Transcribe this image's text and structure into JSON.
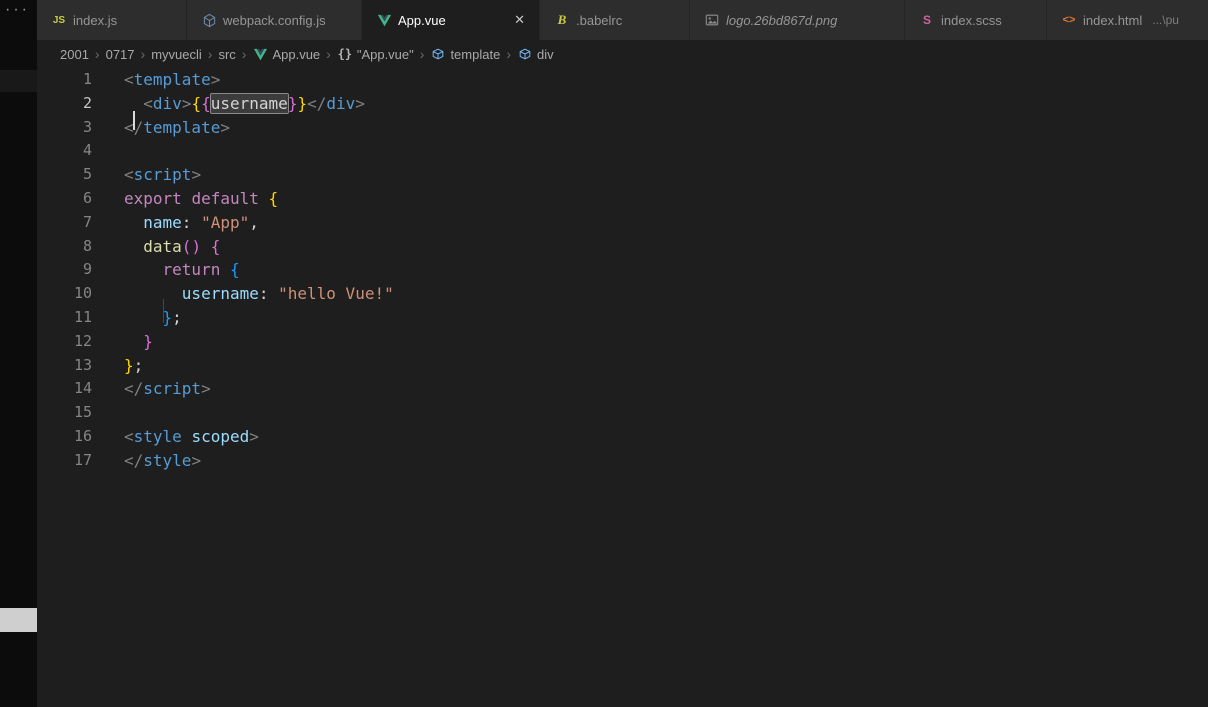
{
  "colors": {
    "editor_bg": "#1e1e1e",
    "tabbar_bg": "#252526",
    "tab_inactive_bg": "#2d2d2d",
    "activity_bar_bg": "#0c0c0c",
    "vue_green": "#41b883",
    "tag_blue": "#569cd6",
    "string_orange": "#ce9178",
    "keyword_purple": "#c586c0"
  },
  "activity_bar": {
    "overflow_label": "···"
  },
  "breadcrumb_separator": "›",
  "tab_bar": {
    "tabs": [
      {
        "label": "index.js",
        "icon": "javascript",
        "active": false,
        "italic": false
      },
      {
        "label": "webpack.config.js",
        "icon": "webpack",
        "active": false,
        "italic": false
      },
      {
        "label": "App.vue",
        "icon": "vue",
        "active": true,
        "italic": false,
        "close_label": "✕"
      },
      {
        "label": ".babelrc",
        "icon": "babel",
        "active": false,
        "italic": false
      },
      {
        "label": "logo.26bd867d.png",
        "icon": "image",
        "active": false,
        "italic": true
      },
      {
        "label": "index.scss",
        "icon": "sass",
        "active": false,
        "italic": false
      },
      {
        "label": "index.html",
        "icon": "html",
        "active": false,
        "italic": false,
        "description": "...\\pu"
      }
    ]
  },
  "breadcrumbs": [
    {
      "label": "2001"
    },
    {
      "label": "0717"
    },
    {
      "label": "myvuecli"
    },
    {
      "label": "src"
    },
    {
      "label": "App.vue",
      "icon": "vue"
    },
    {
      "label": "\"App.vue\"",
      "icon": "braces"
    },
    {
      "label": "template",
      "icon": "symbol-box"
    },
    {
      "label": "div",
      "icon": "symbol-box"
    }
  ],
  "editor": {
    "lines": [
      {
        "n": "1",
        "tokens": [
          [
            "punct",
            "<"
          ],
          [
            "tag",
            "template"
          ],
          [
            "punct",
            ">"
          ]
        ]
      },
      {
        "n": "2",
        "active": true,
        "tokens": [
          [
            "plain",
            " "
          ],
          [
            "cursor",
            ""
          ],
          [
            "plain",
            " "
          ],
          [
            "punct",
            "<"
          ],
          [
            "tag",
            "div"
          ],
          [
            "punct",
            ">"
          ],
          [
            "b1",
            "{"
          ],
          [
            "b2",
            "{"
          ],
          [
            "hl",
            "username"
          ],
          [
            "b2",
            "}"
          ],
          [
            "b1",
            "}"
          ],
          [
            "punct",
            "</"
          ],
          [
            "tag",
            "div"
          ],
          [
            "punct",
            ">"
          ]
        ]
      },
      {
        "n": "3",
        "tokens": [
          [
            "punct",
            "</"
          ],
          [
            "tag",
            "template"
          ],
          [
            "punct",
            ">"
          ]
        ]
      },
      {
        "n": "4",
        "tokens": []
      },
      {
        "n": "5",
        "tokens": [
          [
            "punct",
            "<"
          ],
          [
            "tag",
            "script"
          ],
          [
            "punct",
            ">"
          ]
        ]
      },
      {
        "n": "6",
        "tokens": [
          [
            "kw",
            "export"
          ],
          [
            "plain",
            " "
          ],
          [
            "kw",
            "default"
          ],
          [
            "plain",
            " "
          ],
          [
            "b1",
            "{"
          ]
        ]
      },
      {
        "n": "7",
        "tokens": [
          [
            "plain",
            "  "
          ],
          [
            "prop",
            "name"
          ],
          [
            "plain",
            ": "
          ],
          [
            "str",
            "\"App\""
          ],
          [
            "plain",
            ","
          ]
        ]
      },
      {
        "n": "8",
        "tokens": [
          [
            "plain",
            "  "
          ],
          [
            "fn",
            "data"
          ],
          [
            "b2",
            "("
          ],
          [
            "b2",
            ")"
          ],
          [
            "plain",
            " "
          ],
          [
            "b2",
            "{"
          ]
        ]
      },
      {
        "n": "9",
        "tokens": [
          [
            "plain",
            "    "
          ],
          [
            "kw",
            "return"
          ],
          [
            "plain",
            " "
          ],
          [
            "b3",
            "{"
          ]
        ]
      },
      {
        "n": "10",
        "tokens": [
          [
            "plain",
            "    "
          ],
          [
            "guide",
            ""
          ],
          [
            "plain",
            "  "
          ],
          [
            "prop",
            "username"
          ],
          [
            "plain",
            ": "
          ],
          [
            "str",
            "\"hello Vue!\""
          ]
        ]
      },
      {
        "n": "11",
        "tokens": [
          [
            "plain",
            "    "
          ],
          [
            "b3",
            "}"
          ],
          [
            "plain",
            ";"
          ]
        ]
      },
      {
        "n": "12",
        "tokens": [
          [
            "plain",
            "  "
          ],
          [
            "b2",
            "}"
          ]
        ]
      },
      {
        "n": "13",
        "tokens": [
          [
            "b1",
            "}"
          ],
          [
            "plain",
            ";"
          ]
        ]
      },
      {
        "n": "14",
        "tokens": [
          [
            "punct",
            "</"
          ],
          [
            "tag",
            "script"
          ],
          [
            "punct",
            ">"
          ]
        ]
      },
      {
        "n": "15",
        "tokens": []
      },
      {
        "n": "16",
        "tokens": [
          [
            "punct",
            "<"
          ],
          [
            "tag",
            "style"
          ],
          [
            "plain",
            " "
          ],
          [
            "attr",
            "scoped"
          ],
          [
            "punct",
            ">"
          ]
        ]
      },
      {
        "n": "17",
        "tokens": [
          [
            "punct",
            "</"
          ],
          [
            "tag",
            "style"
          ],
          [
            "punct",
            ">"
          ]
        ]
      }
    ]
  }
}
